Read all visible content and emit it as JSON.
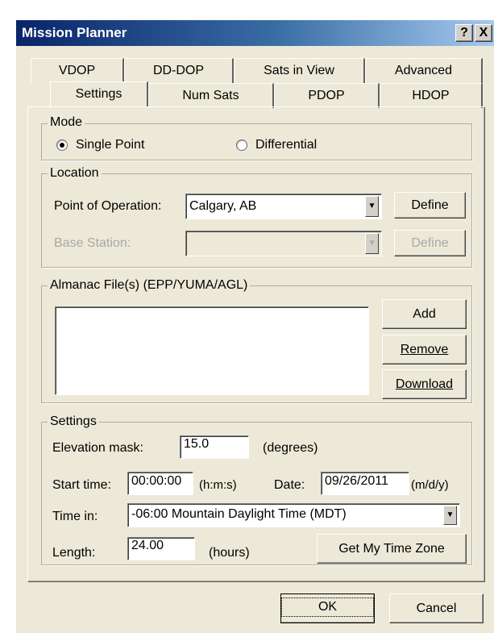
{
  "window": {
    "title": "Mission Planner",
    "help_btn": "?",
    "close_btn": "X"
  },
  "tabs": {
    "row_back": [
      "VDOP",
      "DD-DOP",
      "Sats in View",
      "Advanced"
    ],
    "row_front": [
      "Settings",
      "Num Sats",
      "PDOP",
      "HDOP"
    ],
    "active": "Settings"
  },
  "mode": {
    "label": "Mode",
    "single_point": "Single Point",
    "differential": "Differential",
    "selected": "Single Point"
  },
  "location": {
    "label": "Location",
    "point_label": "Point of Operation:",
    "point_value": "Calgary, AB",
    "define": "Define",
    "base_label": "Base Station:",
    "base_value": "",
    "base_define": "Define"
  },
  "almanac": {
    "label": "Almanac File(s) (EPP/YUMA/AGL)",
    "files": [],
    "add": "Add",
    "remove": "Remove",
    "download": "Download"
  },
  "settings": {
    "label": "Settings",
    "elev_label": "Elevation mask:",
    "elev_value": "15.0",
    "elev_unit": "(degrees)",
    "start_label": "Start time:",
    "start_value": "00:00:00",
    "start_unit": "(h:m:s)",
    "date_label": "Date:",
    "date_value": "09/26/2011",
    "date_unit": "(m/d/y)",
    "timein_label": "Time in:",
    "timein_value": "-06:00  Mountain Daylight Time (MDT)",
    "length_label": "Length:",
    "length_value": "24.00",
    "length_unit": "(hours)",
    "tz_button": "Get My Time Zone"
  },
  "footer": {
    "ok": "OK",
    "cancel": "Cancel"
  }
}
